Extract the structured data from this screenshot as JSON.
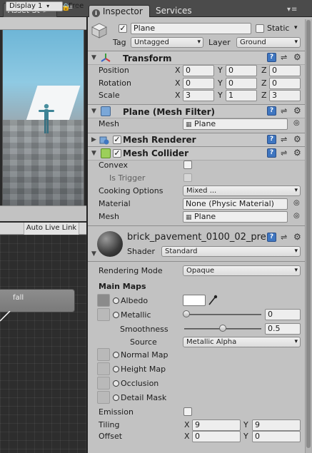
{
  "left": {
    "asset_tab": "Asset St",
    "display_dropdown": "Display 1",
    "free_label": "Free",
    "auto_live_link": "Auto Live Link",
    "state_node": "fall"
  },
  "tabs": {
    "inspector": "Inspector",
    "services": "Services"
  },
  "object": {
    "active": true,
    "name": "Plane",
    "static_label": "Static",
    "static": false,
    "tag_label": "Tag",
    "tag_value": "Untagged",
    "layer_label": "Layer",
    "layer_value": "Ground"
  },
  "transform": {
    "title": "Transform",
    "position_label": "Position",
    "rotation_label": "Rotation",
    "scale_label": "Scale",
    "axis_x": "X",
    "axis_y": "Y",
    "axis_z": "Z",
    "position": [
      "0",
      "0",
      "0"
    ],
    "rotation": [
      "0",
      "0",
      "0"
    ],
    "scale": [
      "3",
      "1",
      "3"
    ]
  },
  "mesh_filter": {
    "title": "Plane (Mesh Filter)",
    "mesh_label": "Mesh",
    "mesh_value": "Plane"
  },
  "mesh_renderer": {
    "title": "Mesh Renderer",
    "enabled": true
  },
  "mesh_collider": {
    "title": "Mesh Collider",
    "enabled": true,
    "convex_label": "Convex",
    "is_trigger_label": "Is Trigger",
    "cooking_label": "Cooking Options",
    "cooking_value": "Mixed ...",
    "material_label": "Material",
    "material_value": "None (Physic Material)",
    "mesh_label": "Mesh",
    "mesh_value": "Plane"
  },
  "material": {
    "name": "brick_pavement_0100_02_pre",
    "shader_label": "Shader",
    "shader_value": "Standard",
    "rendering_mode_label": "Rendering Mode",
    "rendering_mode_value": "Opaque",
    "main_maps_label": "Main Maps",
    "albedo_label": "Albedo",
    "metallic_label": "Metallic",
    "metallic_value": "0",
    "metallic_level": 0.0,
    "smoothness_label": "Smoothness",
    "smoothness_value": "0.5",
    "smoothness_level": 0.5,
    "source_label": "Source",
    "source_value": "Metallic Alpha",
    "normal_map_label": "Normal Map",
    "height_map_label": "Height Map",
    "occlusion_label": "Occlusion",
    "detail_mask_label": "Detail Mask",
    "emission_label": "Emission",
    "tiling_label": "Tiling",
    "tiling": [
      "9",
      "9"
    ],
    "offset_label": "Offset",
    "offset": [
      "0",
      "0"
    ],
    "axis_x": "X",
    "axis_y": "Y"
  },
  "colors": {
    "inspector_bg": "#c2c2c2",
    "dark_chrome": "#4b4b4b",
    "help_blue": "#3f76c0",
    "albedo_color": "#ffffff"
  },
  "icons": {
    "menu": "kebab-menu-icon",
    "help": "help-book-icon",
    "preset": "preset-sliders-icon",
    "gear": "gear-icon",
    "picker": "eyedropper-icon",
    "object_selector": "target-circle-icon"
  }
}
